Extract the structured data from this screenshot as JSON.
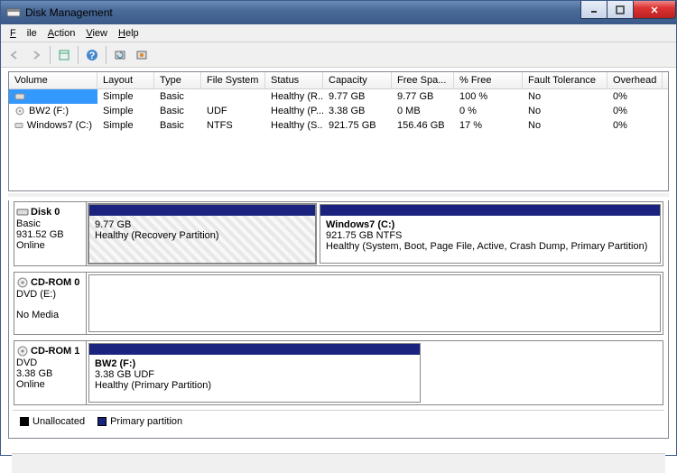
{
  "window": {
    "title": "Disk Management"
  },
  "menu": {
    "file": "File",
    "action": "Action",
    "view": "View",
    "help": "Help"
  },
  "columns": {
    "volume": "Volume",
    "layout": "Layout",
    "type": "Type",
    "filesystem": "File System",
    "status": "Status",
    "capacity": "Capacity",
    "freespace": "Free Spa...",
    "pctfree": "% Free",
    "fault": "Fault Tolerance",
    "overhead": "Overhead"
  },
  "volumes": [
    {
      "name": "",
      "layout": "Simple",
      "type": "Basic",
      "fs": "",
      "status": "Healthy (R...",
      "capacity": "9.77 GB",
      "free": "9.77 GB",
      "pct": "100 %",
      "fault": "No",
      "overhead": "0%",
      "selected": true
    },
    {
      "name": "BW2 (F:)",
      "layout": "Simple",
      "type": "Basic",
      "fs": "UDF",
      "status": "Healthy (P...",
      "capacity": "3.38 GB",
      "free": "0 MB",
      "pct": "0 %",
      "fault": "No",
      "overhead": "0%",
      "selected": false
    },
    {
      "name": "Windows7 (C:)",
      "layout": "Simple",
      "type": "Basic",
      "fs": "NTFS",
      "status": "Healthy (S...",
      "capacity": "921.75 GB",
      "free": "156.46 GB",
      "pct": "17 %",
      "fault": "No",
      "overhead": "0%",
      "selected": false
    }
  ],
  "disks": {
    "disk0": {
      "title": "Disk 0",
      "type": "Basic",
      "size": "931.52 GB",
      "state": "Online",
      "p1": {
        "size": "9.77 GB",
        "status": "Healthy (Recovery Partition)"
      },
      "p2": {
        "name": "Windows7  (C:)",
        "size": "921.75 GB NTFS",
        "status": "Healthy (System, Boot, Page File, Active, Crash Dump, Primary Partition)"
      }
    },
    "cdrom0": {
      "title": "CD-ROM 0",
      "type": "DVD (E:)",
      "state": "No Media"
    },
    "cdrom1": {
      "title": "CD-ROM 1",
      "type": "DVD",
      "size": "3.38 GB",
      "state": "Online",
      "p1": {
        "name": "BW2  (F:)",
        "size": "3.38 GB UDF",
        "status": "Healthy (Primary Partition)"
      }
    }
  },
  "legend": {
    "unallocated": "Unallocated",
    "primary": "Primary partition"
  }
}
